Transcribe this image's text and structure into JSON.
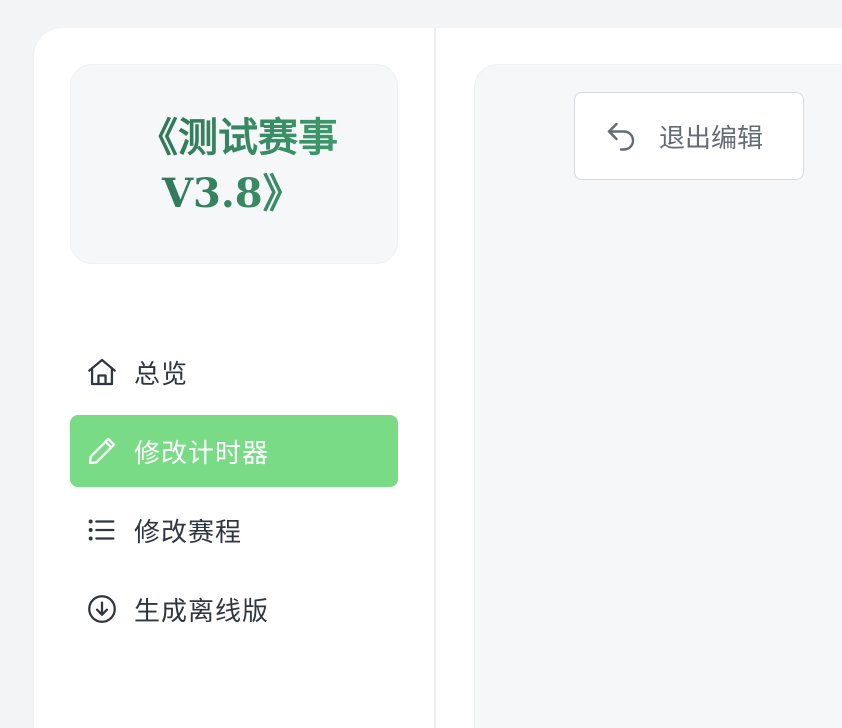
{
  "sidebar": {
    "title_line1": "《测试赛事",
    "title_line2": "V3.8》",
    "items": [
      {
        "label": "总览",
        "icon": "home-icon",
        "active": false
      },
      {
        "label": "修改计时器",
        "icon": "pencil-icon",
        "active": true
      },
      {
        "label": "修改赛程",
        "icon": "list-icon",
        "active": false
      },
      {
        "label": "生成离线版",
        "icon": "download-circle-icon",
        "active": false
      }
    ]
  },
  "main": {
    "exit_button": {
      "label": "退出编辑",
      "icon": "undo-arrow-icon"
    }
  },
  "colors": {
    "accent": "#7adb87",
    "title_gradient_start": "#2e6f53",
    "title_gradient_end": "#3f9e70",
    "nav_text": "#2f3542",
    "button_text": "#646b76"
  }
}
